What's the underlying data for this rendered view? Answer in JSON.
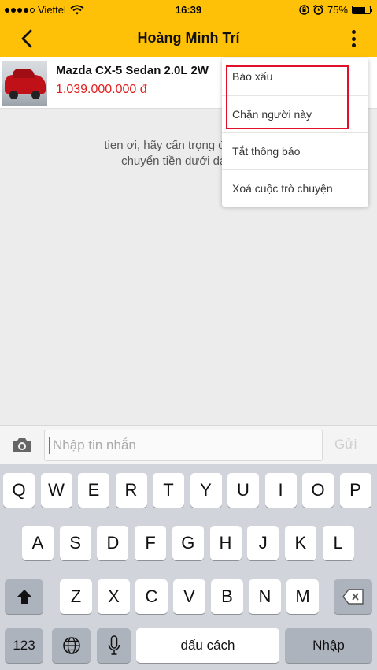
{
  "status_bar": {
    "carrier": "Viettel",
    "time": "16:39",
    "battery": "75%",
    "battery_level": 0.75
  },
  "nav": {
    "title": "Hoàng Minh Trí"
  },
  "listing": {
    "title": "Mazda CX-5 Sedan 2.0L 2W",
    "price": "1.039.000.000 đ"
  },
  "chat": {
    "warning": "tien ơi, hãy cẩn trọng đừng gửi t\nchuyển tiền dưới danh ng"
  },
  "menu": {
    "items": [
      {
        "label": "Báo xấu"
      },
      {
        "label": "Chặn người này"
      },
      {
        "label": "Tắt thông báo"
      },
      {
        "label": "Xoá cuộc trò chuyện"
      }
    ],
    "highlight_color": "#e0102a"
  },
  "composer": {
    "placeholder": "Nhập tin nhắn",
    "send_label": "Gửi"
  },
  "keyboard": {
    "row1": [
      "Q",
      "W",
      "E",
      "R",
      "T",
      "Y",
      "U",
      "I",
      "O",
      "P"
    ],
    "row2": [
      "A",
      "S",
      "D",
      "F",
      "G",
      "H",
      "J",
      "K",
      "L"
    ],
    "row3": [
      "Z",
      "X",
      "C",
      "V",
      "B",
      "N",
      "M"
    ],
    "numbers_label": "123",
    "space_label": "dấu cách",
    "return_label": "Nhập"
  },
  "colors": {
    "accent": "#ffc107",
    "price": "#e02020"
  }
}
